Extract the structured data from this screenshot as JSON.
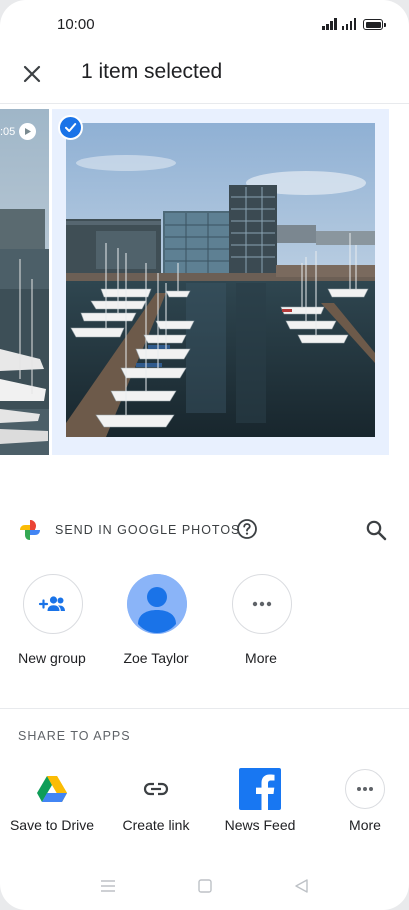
{
  "status_bar": {
    "time": "10:00"
  },
  "header": {
    "title": "1 item selected",
    "close_icon": "close-icon"
  },
  "photos": {
    "previous_video_duration": ":05",
    "selected_count": 1
  },
  "send_section": {
    "label": "SEND IN GOOGLE PHOTOS",
    "contacts": [
      {
        "name": "New group",
        "icon": "group-add-icon"
      },
      {
        "name": "Zoe Taylor",
        "icon": "person-avatar"
      },
      {
        "name": "More",
        "icon": "more-horizontal-icon"
      }
    ]
  },
  "share_section": {
    "label": "SHARE TO APPS",
    "apps": [
      {
        "label": "Save to Drive",
        "icon": "google-drive-icon"
      },
      {
        "label": "Create link",
        "icon": "link-icon"
      },
      {
        "label": "News Feed",
        "icon": "facebook-icon"
      },
      {
        "label": "More",
        "icon": "more-horizontal-icon"
      }
    ]
  },
  "colors": {
    "accent": "#1a73e8",
    "selected_bg": "#e8f0fe",
    "facebook": "#1877f2"
  }
}
